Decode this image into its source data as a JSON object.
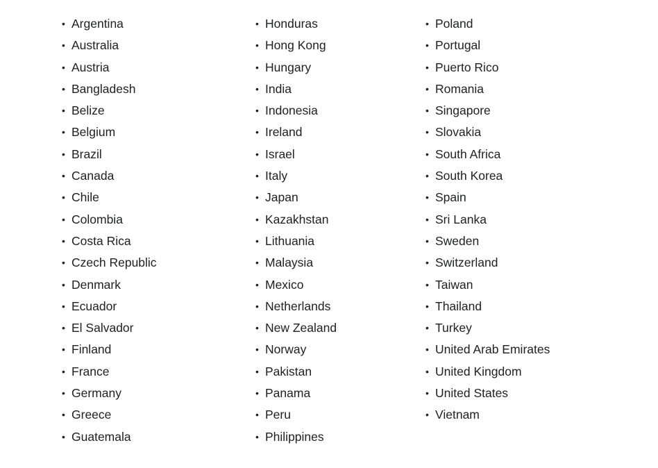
{
  "columns": [
    [
      "Argentina",
      "Australia",
      "Austria",
      "Bangladesh",
      "Belize",
      "Belgium",
      "Brazil",
      "Canada",
      "Chile",
      "Colombia",
      "Costa Rica",
      "Czech Republic",
      "Denmark",
      "Ecuador",
      "El Salvador",
      "Finland",
      "France",
      "Germany",
      "Greece",
      "Guatemala"
    ],
    [
      "Honduras",
      "Hong Kong",
      "Hungary",
      "India",
      "Indonesia",
      "Ireland",
      "Israel",
      "Italy",
      "Japan",
      "Kazakhstan",
      "Lithuania",
      "Malaysia",
      "Mexico",
      "Netherlands",
      "New Zealand",
      "Norway",
      "Pakistan",
      "Panama",
      "Peru",
      "Philippines"
    ],
    [
      "Poland",
      "Portugal",
      "Puerto Rico",
      "Romania",
      "Singapore",
      "Slovakia",
      "South Africa",
      "South Korea",
      "Spain",
      "Sri Lanka",
      "Sweden",
      "Switzerland",
      "Taiwan",
      "Thailand",
      "Turkey",
      "United Arab Emirates",
      "United Kingdom",
      "United States",
      "Vietnam"
    ]
  ],
  "bullet": "•"
}
